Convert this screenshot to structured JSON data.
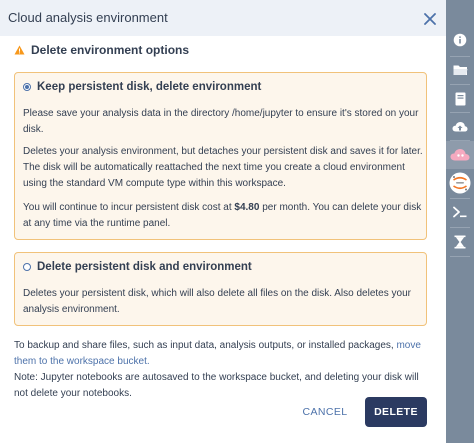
{
  "panel": {
    "title": "Cloud analysis environment"
  },
  "section": {
    "heading": "Delete environment options"
  },
  "options": {
    "keep": {
      "label": "Keep persistent disk, delete environment",
      "selected": true,
      "para1": "Please save your analysis data in the directory /home/jupyter to ensure it's stored on your disk.",
      "para2": "Deletes your analysis environment, but detaches your persistent disk and saves it for later. The disk will be automatically reattached the next time you create a cloud environment using the standard VM compute type within this workspace.",
      "para3_before": "You will continue to incur persistent disk cost at ",
      "price": "$4.80",
      "para3_after": " per month. You can delete your disk at any time via the runtime panel."
    },
    "delete": {
      "label": "Delete persistent disk and environment",
      "selected": false,
      "para1": "Deletes your persistent disk, which will also delete all files on the disk. Also deletes your analysis environment."
    }
  },
  "footer": {
    "backup_before": "To backup and share files, such as input data, analysis outputs, or installed packages, ",
    "backup_link": "move them to the workspace bucket.",
    "note": "Note: Jupyter notebooks are autosaved to the workspace bucket, and deleting your disk will not delete your notebooks."
  },
  "buttons": {
    "cancel": "CANCEL",
    "delete": "DELETE"
  },
  "rail": {
    "items": [
      {
        "icon": "info-icon"
      },
      {
        "icon": "folder-icon"
      },
      {
        "icon": "book-icon"
      },
      {
        "icon": "cloud-upload-icon"
      },
      {
        "icon": "cloud-environment-icon"
      },
      {
        "icon": "jupyter-icon"
      },
      {
        "icon": "terminal-icon"
      },
      {
        "icon": "hourglass-icon"
      }
    ]
  },
  "colors": {
    "accent": "#4d72aa",
    "primary_button": "#2b3a61",
    "warning": "#f7981c",
    "card_border": "#f1c27a",
    "card_background": "#fdf6ec",
    "rail": "#7a8a9c",
    "header": "#edf1f7"
  }
}
